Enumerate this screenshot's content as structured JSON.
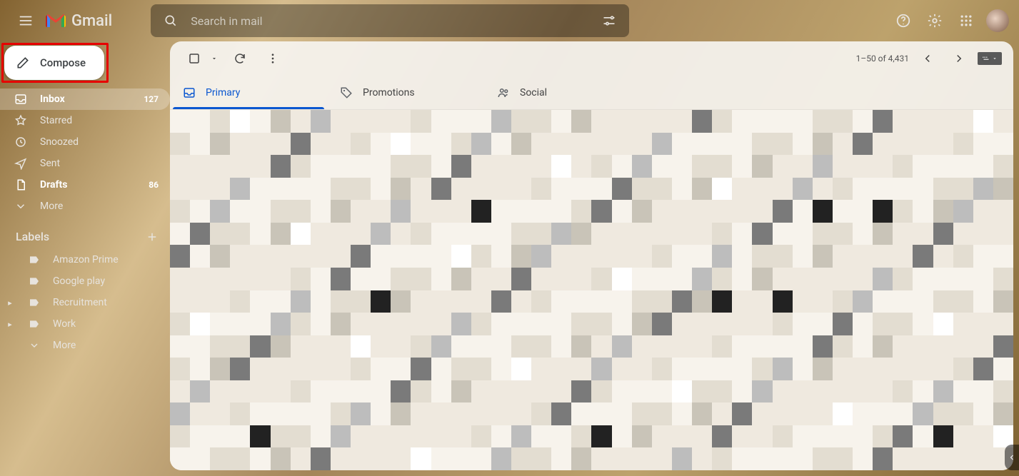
{
  "header": {
    "product": "Gmail",
    "search_placeholder": "Search in mail"
  },
  "compose": {
    "label": "Compose"
  },
  "sidebar": {
    "items": [
      {
        "label": "Inbox",
        "count": "127",
        "bold": true,
        "active": true
      },
      {
        "label": "Starred",
        "count": "",
        "bold": false
      },
      {
        "label": "Snoozed",
        "count": "",
        "bold": false
      },
      {
        "label": "Sent",
        "count": "",
        "bold": false
      },
      {
        "label": "Drafts",
        "count": "86",
        "bold": true
      },
      {
        "label": "More",
        "count": "",
        "bold": false
      }
    ],
    "labels_header": "Labels",
    "labels": [
      {
        "label": "Amazon Prime",
        "exp": false
      },
      {
        "label": "Google play",
        "exp": false
      },
      {
        "label": "Recruitment",
        "exp": true
      },
      {
        "label": "Work",
        "exp": true
      },
      {
        "label": "More",
        "exp": false,
        "more": true
      }
    ]
  },
  "tabs": [
    {
      "label": "Primary",
      "active": true
    },
    {
      "label": "Promotions",
      "active": false
    },
    {
      "label": "Social",
      "active": false
    }
  ],
  "toolbar": {
    "range": "1–50 of 4,431"
  }
}
